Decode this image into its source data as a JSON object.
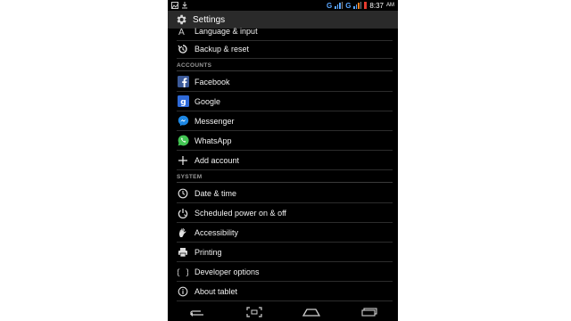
{
  "status_bar": {
    "network_1": "G",
    "network_2": "G",
    "time": "8:37",
    "time_suffix": "AM"
  },
  "action_bar": {
    "title": "Settings"
  },
  "items_top": [
    {
      "label": "Language & input",
      "icon": "language-icon"
    },
    {
      "label": "Backup & reset",
      "icon": "backup-reset-icon"
    }
  ],
  "sections": {
    "accounts": "ACCOUNTS",
    "system": "SYSTEM"
  },
  "accounts": [
    {
      "label": "Facebook",
      "icon": "facebook-icon"
    },
    {
      "label": "Google",
      "icon": "google-icon"
    },
    {
      "label": "Messenger",
      "icon": "messenger-icon"
    },
    {
      "label": "WhatsApp",
      "icon": "whatsapp-icon"
    },
    {
      "label": "Add account",
      "icon": "add-icon"
    }
  ],
  "system": [
    {
      "label": "Date & time",
      "icon": "clock-icon"
    },
    {
      "label": "Scheduled power on & off",
      "icon": "scheduled-power-icon"
    },
    {
      "label": "Accessibility",
      "icon": "accessibility-icon"
    },
    {
      "label": "Printing",
      "icon": "printer-icon"
    },
    {
      "label": "Developer options",
      "icon": "developer-options-icon"
    },
    {
      "label": "About tablet",
      "icon": "info-icon"
    }
  ],
  "nav_bar": {
    "back": "back-icon",
    "screenshot": "screenshot-icon",
    "home": "home-icon",
    "recents": "recents-icon"
  },
  "colors": {
    "accent_signal": "#5aa6ff",
    "facebook": "#3b5998",
    "google": "#2f6ad8",
    "messenger": "#1e88e5",
    "whatsapp": "#43c553",
    "marker": "#e21d1d"
  }
}
